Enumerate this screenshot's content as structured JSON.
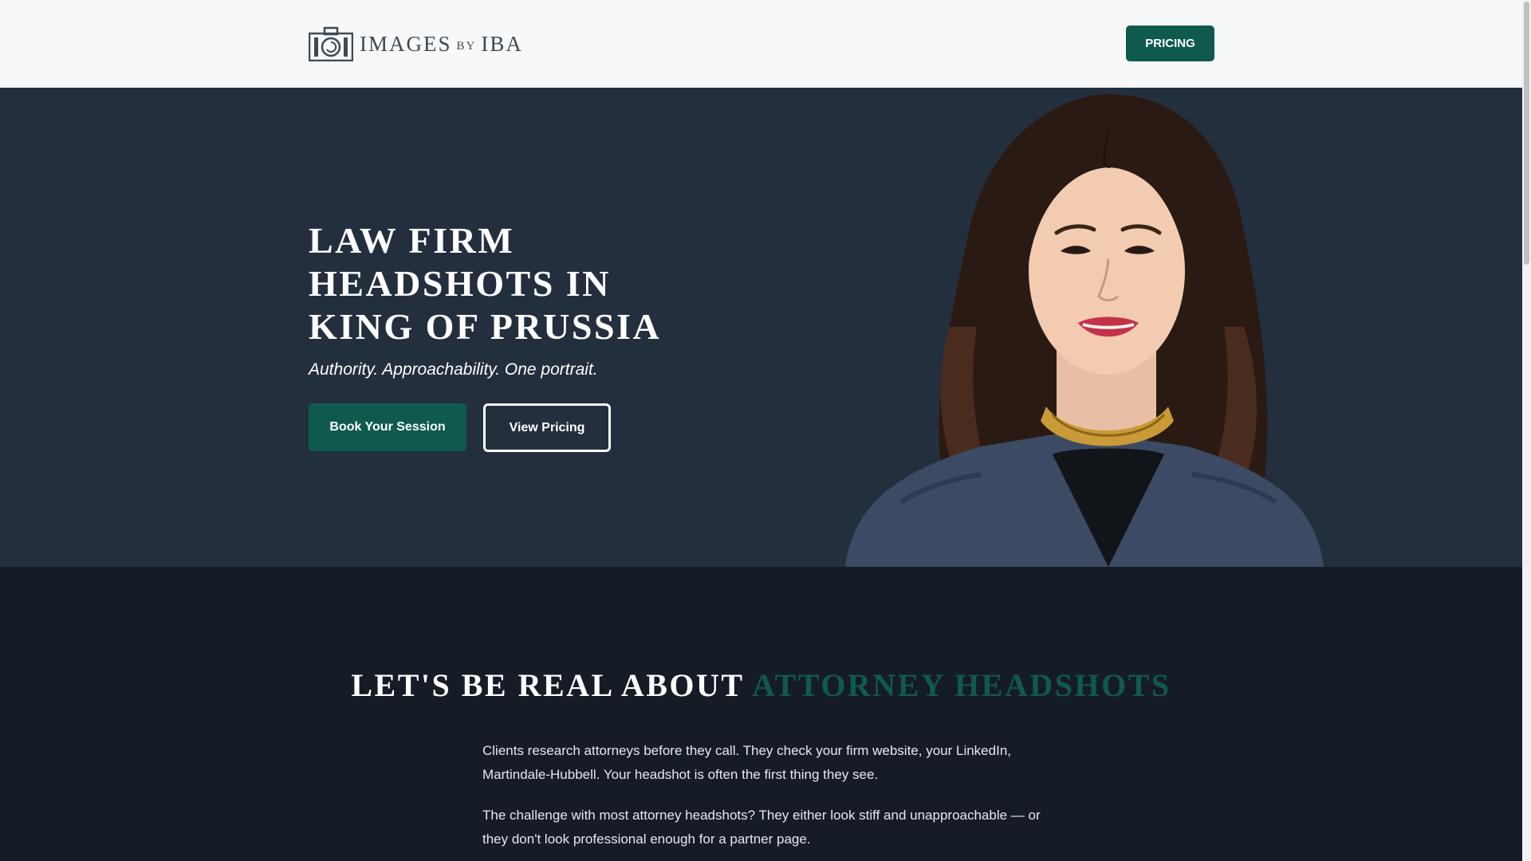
{
  "header": {
    "logo": {
      "main": "IMAGES",
      "by": "BY",
      "brand": "IBA"
    },
    "pricing_label": "PRICING"
  },
  "hero": {
    "title": "LAW FIRM HEADSHOTS IN KING OF PRUSSIA",
    "tagline": "Authority. Approachability. One portrait.",
    "primary_button": "Book Your Session",
    "secondary_button": "View Pricing"
  },
  "section": {
    "heading_main": "LET'S BE REAL ABOUT ",
    "heading_accent": "ATTORNEY HEADSHOTS",
    "paragraphs": [
      "Clients research attorneys before they call. They check your firm website, your LinkedIn, Martindale-Hubbell. Your headshot is often the first thing they see.",
      "The challenge with most attorney headshots? They either look stiff and unapproachable — or they don't look professional enough for a partner page."
    ]
  },
  "colors": {
    "header_bg": "#f7f8f9",
    "hero_bg": "#242f3e",
    "section_bg": "#151c26",
    "brand_green": "#0f5a4c",
    "text_light": "#ffffff"
  }
}
